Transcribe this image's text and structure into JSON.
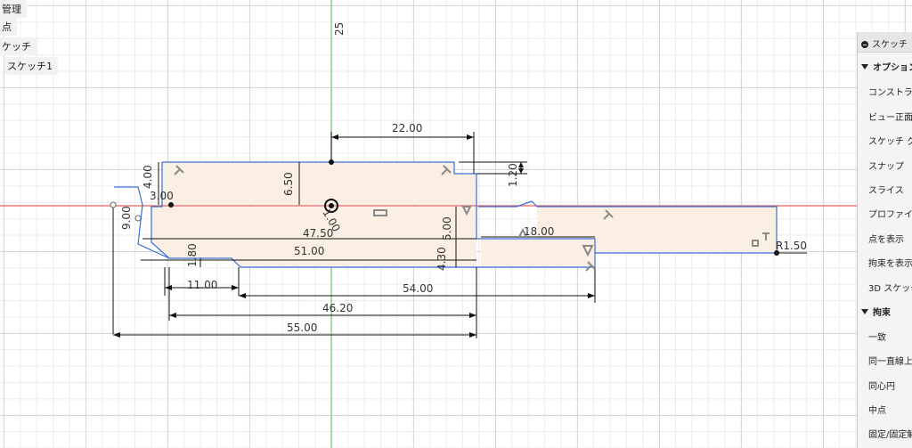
{
  "browser": {
    "items": [
      "管理",
      "点",
      "ケッチ",
      "スケッチ1"
    ]
  },
  "axis_label": "25",
  "panel": {
    "title": "スケッチ",
    "options_section": "オプション",
    "options": [
      "コンストラ",
      "ビュー正面",
      "スケッチ グ",
      "スナップ",
      "スライス",
      "プロファイル",
      "点を表示",
      "拘束を表示",
      "3D スケッチ"
    ],
    "constraints_section": "拘束",
    "constraints": [
      "一致",
      "同一直線上",
      "同心円",
      "中点",
      "固定/固定解"
    ]
  },
  "dims": {
    "d2200": "22.00",
    "d120": "1.20",
    "d650": "6.50",
    "d400": "4.00",
    "d300": "3.00",
    "d900": "9.00",
    "d100": "1.00",
    "d500": "5.00",
    "d4750": "47.50",
    "d1800": "18.00",
    "d5100": "51.00",
    "d180": "1.80",
    "d430": "4.30",
    "d1100": "11.00",
    "d5400": "54.00",
    "d4620": "46.20",
    "d5500": "55.00",
    "r150": "R1.50"
  },
  "colors": {
    "profile_fill": "#fbeee2",
    "sketch_line": "#3a6fd8",
    "x_axis": "#e06060",
    "y_axis": "#7bd07b"
  }
}
